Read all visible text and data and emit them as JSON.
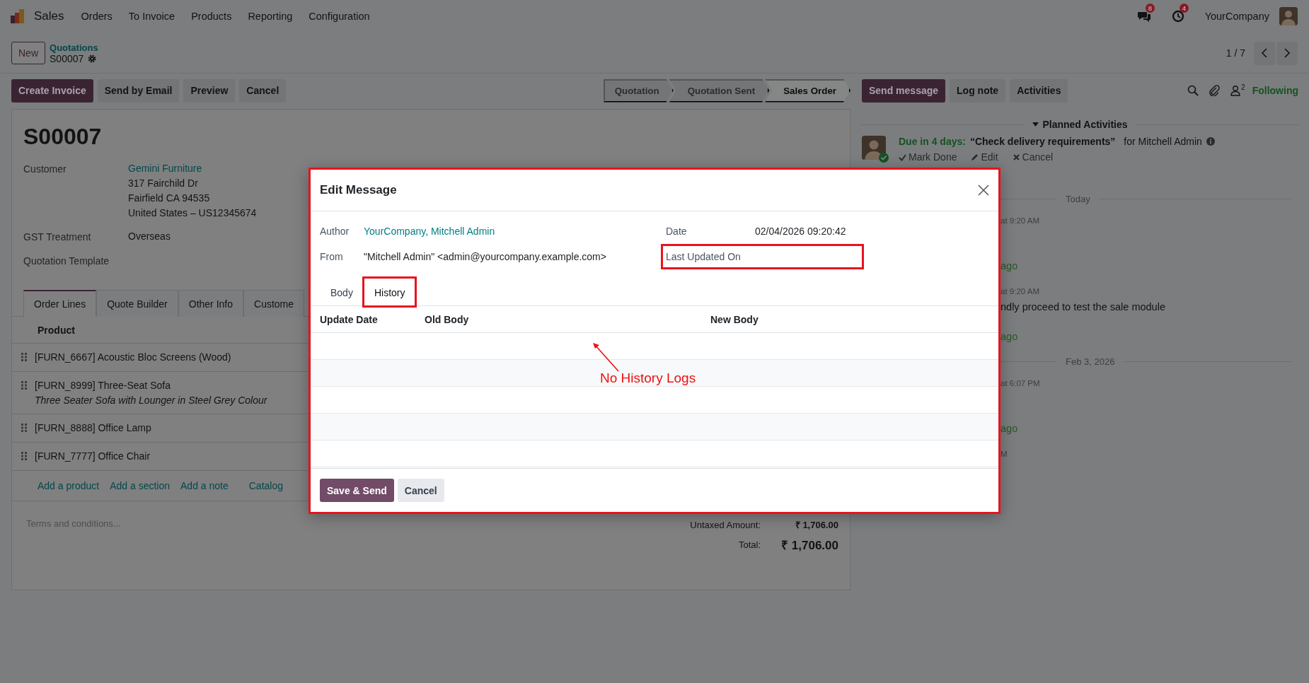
{
  "navbar": {
    "app": "Sales",
    "menu": [
      "Orders",
      "To Invoice",
      "Products",
      "Reporting",
      "Configuration"
    ],
    "notifications": [
      {
        "kind": "messages",
        "count": "8"
      },
      {
        "kind": "activities",
        "count": "4"
      }
    ],
    "company": "YourCompany"
  },
  "breadcrumb": {
    "new_button": "New",
    "parent": "Quotations",
    "current": "S00007",
    "pager": "1 / 7"
  },
  "actions": [
    {
      "label": "Create Invoice",
      "kind": "primary"
    },
    {
      "label": "Send by Email",
      "kind": "secondary"
    },
    {
      "label": "Preview",
      "kind": "secondary"
    },
    {
      "label": "Cancel",
      "kind": "secondary"
    }
  ],
  "statusbar": [
    {
      "label": "Quotation",
      "selected": false
    },
    {
      "label": "Quotation Sent",
      "selected": false
    },
    {
      "label": "Sales Order",
      "selected": true
    }
  ],
  "form": {
    "title": "S00007",
    "customer": {
      "label": "Customer",
      "name": "Gemini Furniture",
      "address": [
        "317 Fairchild Dr",
        "Fairfield CA 94535",
        "United States – US12345674"
      ]
    },
    "fields": [
      {
        "label": "GST Treatment",
        "value": "Overseas"
      },
      {
        "label": "Quotation Template"
      }
    ],
    "tabs": [
      {
        "label": "Order Lines",
        "selected": true
      },
      {
        "label": "Quote Builder",
        "selected": false
      },
      {
        "label": "Other Info",
        "selected": false
      },
      {
        "label": "Custome",
        "selected": false
      }
    ],
    "column": "Product",
    "lines": [
      {
        "product": "[FURN_6667] Acoustic Bloc Screens (Wood)"
      },
      {
        "product": "[FURN_8999] Three-Seat Sofa",
        "description": "Three Seater Sofa with Lounger in Steel Grey Colour"
      },
      {
        "product": "[FURN_8888] Office Lamp"
      },
      {
        "product": "[FURN_7777] Office Chair"
      }
    ],
    "add_links": [
      "Add a product",
      "Add a section",
      "Add a note"
    ],
    "catalog": "Catalog",
    "terms_placeholder": "Terms and conditions...",
    "totals": [
      {
        "label": "Untaxed Amount:",
        "value": "₹ 1,706.00",
        "kind": "subtotal"
      },
      {
        "label": "Total:",
        "value": "₹ 1,706.00",
        "kind": "total"
      }
    ]
  },
  "chatter": {
    "buttons": [
      {
        "label": "Send message",
        "kind": "primary"
      },
      {
        "label": "Log note",
        "kind": "secondary"
      },
      {
        "label": "Activities",
        "kind": "secondary"
      }
    ],
    "followers": "2",
    "follow": "Following",
    "planned": {
      "title": "Planned Activities",
      "due": "Due in 4 days:",
      "summary": "“Check delivery requirements”",
      "assignee": "for Mitchell Admin",
      "actions": [
        {
          "label": "Mark Done",
          "kind": "done"
        },
        {
          "label": "Edit",
          "kind": "edit"
        },
        {
          "label": "Cancel",
          "kind": "cancel"
        }
      ]
    },
    "feed": [
      {
        "kind": "date",
        "text": "Today"
      },
      {
        "kind": "message",
        "time": "at 9:20 AM",
        "ago": "ago"
      },
      {
        "kind": "message",
        "time": "at 9:20 AM",
        "body": "ndly proceed to test the sale module",
        "ago": "ago"
      },
      {
        "kind": "date",
        "text": "Feb 3, 2026"
      },
      {
        "kind": "message",
        "time": "at 6:07 PM",
        "ago": "ago"
      },
      {
        "kind": "time",
        "text": "M"
      }
    ]
  },
  "dialog": {
    "title": "Edit Message",
    "highlighted": true,
    "fields": [
      {
        "label": "Author",
        "value": "YourCompany, Mitchell Admin",
        "kind": "link"
      },
      {
        "label": "From",
        "value": "\"Mitchell Admin\" <admin@yourcompany.example.com>",
        "kind": "text"
      }
    ],
    "side_fields": [
      {
        "label": "Date",
        "value": "02/04/2026 09:20:42",
        "highlighted": false
      },
      {
        "label": "Last Updated On",
        "highlighted": true
      }
    ],
    "tabs": [
      {
        "label": "Body",
        "selected": false,
        "highlighted": false
      },
      {
        "label": "History",
        "selected": true,
        "highlighted": true
      }
    ],
    "columns": [
      "Update Date",
      "Old Body",
      "New Body"
    ],
    "buttons": [
      {
        "label": "Save & Send",
        "kind": "primary"
      },
      {
        "label": "Cancel",
        "kind": "secondary"
      }
    ],
    "note": "No History Logs"
  }
}
